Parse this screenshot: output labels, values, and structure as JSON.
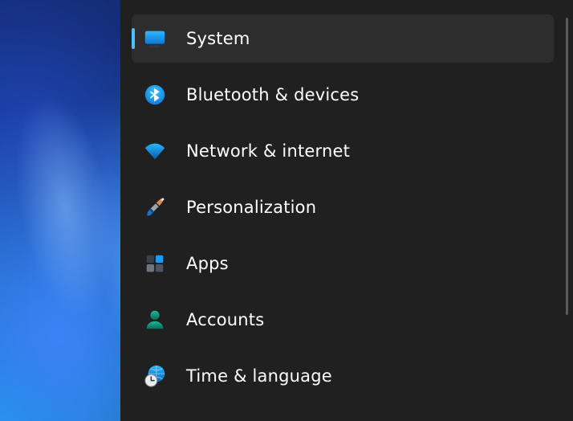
{
  "colors": {
    "panel_bg": "#202020",
    "selected_bg": "#2d2d2d",
    "accent": "#4cc2ff",
    "text": "#ffffff"
  },
  "nav": {
    "selected_index": 0,
    "items": [
      {
        "id": "system",
        "label": "System",
        "icon": "display-icon"
      },
      {
        "id": "bluetooth",
        "label": "Bluetooth & devices",
        "icon": "bluetooth-icon"
      },
      {
        "id": "network",
        "label": "Network & internet",
        "icon": "wifi-icon"
      },
      {
        "id": "personalization",
        "label": "Personalization",
        "icon": "paintbrush-icon"
      },
      {
        "id": "apps",
        "label": "Apps",
        "icon": "apps-icon"
      },
      {
        "id": "accounts",
        "label": "Accounts",
        "icon": "person-icon"
      },
      {
        "id": "time",
        "label": "Time & language",
        "icon": "globe-clock-icon"
      }
    ]
  }
}
